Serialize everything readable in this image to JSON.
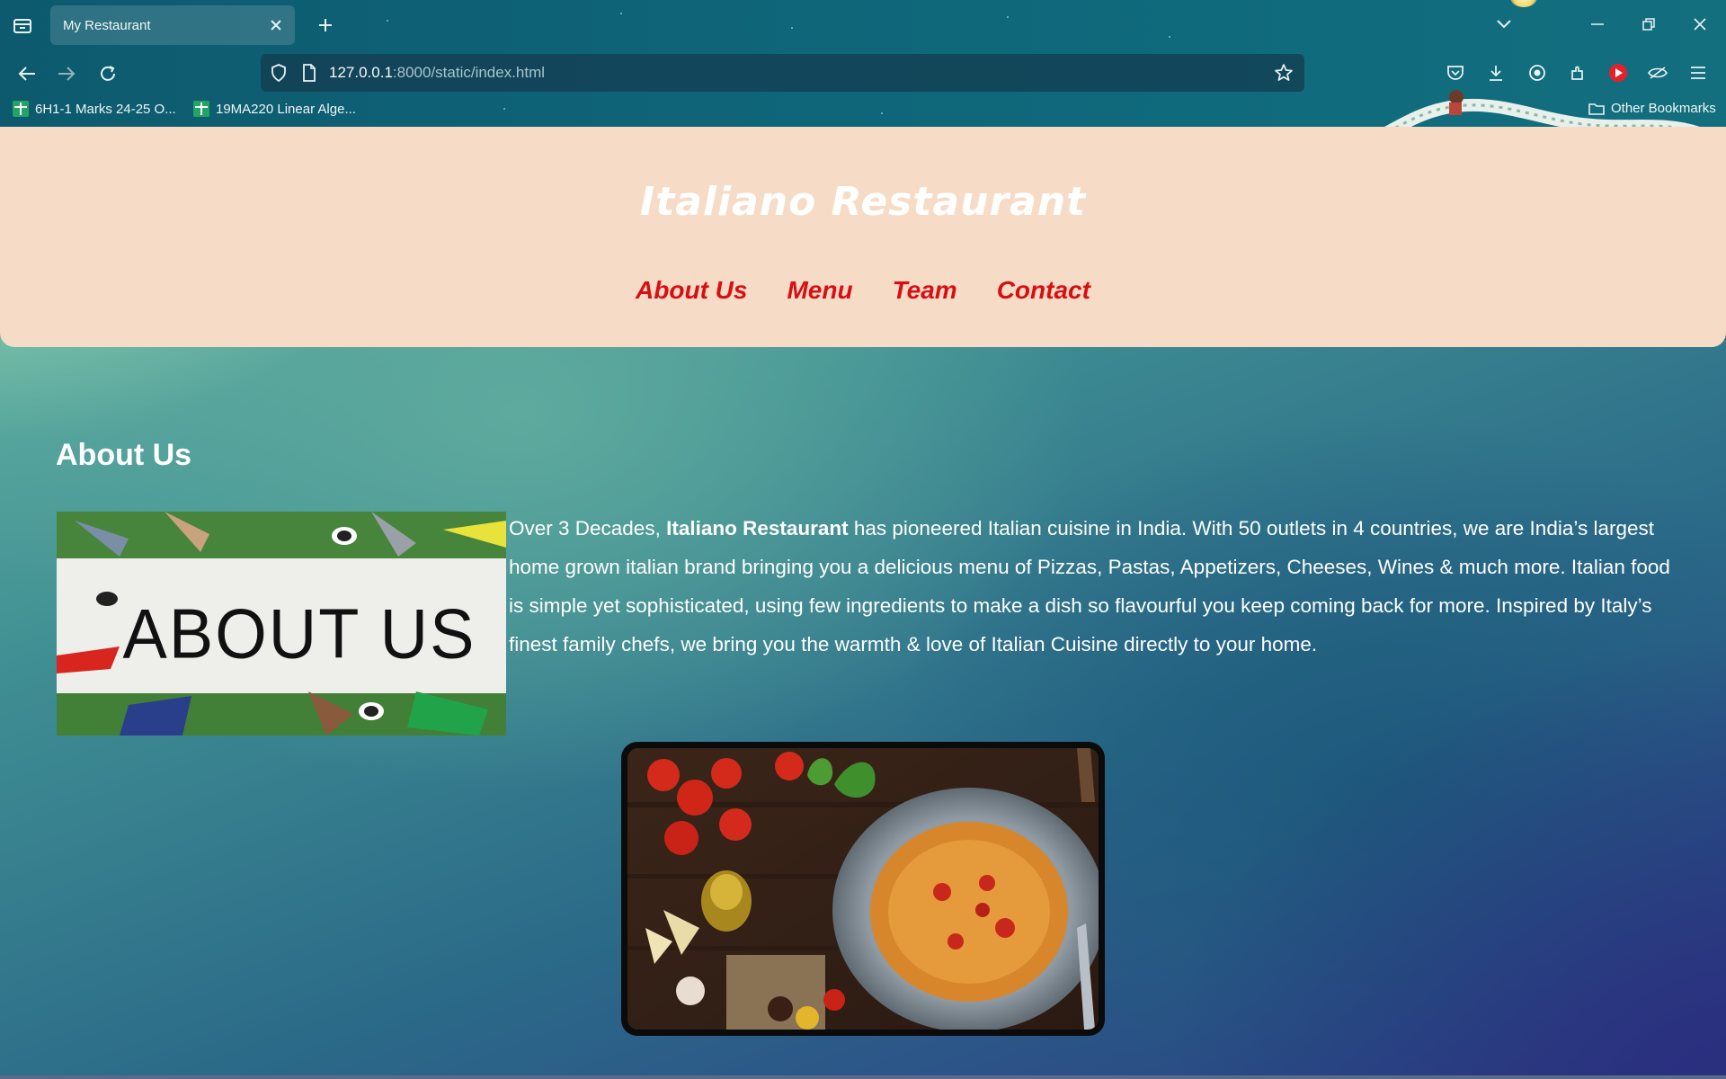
{
  "browser": {
    "tab_title": "My Restaurant",
    "url_host": "127.0.0.1",
    "url_path": ":8000/static/index.html",
    "bookmarks": [
      {
        "label": "6H1-1 Marks 24-25 O..."
      },
      {
        "label": "19MA220 Linear Alge..."
      }
    ],
    "other_bookmarks": "Other Bookmarks"
  },
  "site": {
    "title": "Italiano Restaurant",
    "nav": [
      "About Us",
      "Menu",
      "Team",
      "Contact"
    ]
  },
  "about": {
    "heading": "About Us",
    "image_text": "ABOUT US",
    "text_before": "Over 3 Decades, ",
    "brand": "Italiano Restaurant",
    "text_after": " has pioneered Italian cuisine in India. With 50 outlets in 4 countries, we are India’s largest home grown italian brand bringing you a delicious menu of Pizzas, Pastas, Appetizers, Cheeses, Wines & much more. Italian food is simple yet sophisticated, using few ingredients to make a dish so flavourful you keep coming back for more. Inspired by Italy’s finest family chefs, we bring you the warmth & love of Italian Cuisine directly to your home."
  },
  "colors": {
    "header_bg": "#f6dcc6",
    "nav_link": "#d80f12",
    "title_text": "#ffffff"
  }
}
